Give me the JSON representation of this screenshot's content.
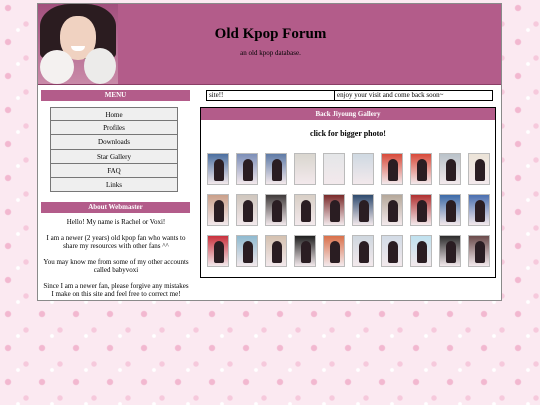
{
  "header": {
    "title": "Old Kpop Forum",
    "subtitle": "an old kpop database."
  },
  "marquee": {
    "left": "site!!",
    "right": "enjoy your visit and come back soon~"
  },
  "sidebar": {
    "menu_heading": "MENU",
    "menu_items": [
      "Home",
      "Profiles",
      "Downloads",
      "Star Gallery",
      "FAQ",
      "Links"
    ],
    "about_heading": "About Webmaster",
    "about_paragraphs": [
      "Hello! My name is Rachel or Voxi!",
      "I am a newer (2 years) old kpop fan who wants to share my resources with other fans ^^",
      "You may know me from some of my other accounts called babyvoxi",
      "Since I am a newer fan, please forgive any mistakes I make on this site and feel free to correct me!"
    ]
  },
  "gallery": {
    "heading": "Back Jiyoung Gallery",
    "instruction": "click for bigger photo!",
    "thumbnails": [
      [
        "#4b6fa0",
        "#7c8fb8",
        "#5e7aa6",
        "#d9d6cf",
        "#e4e6e8",
        "#cfd9e2",
        "#d84a3a",
        "#d84a3a",
        "#b9c2c9",
        "#ece4d8"
      ],
      [
        "#caa08a",
        "#cfc6bd",
        "#3f3a3a",
        "#d8cfc6",
        "#7a2a2a",
        "#2e4a6e",
        "#b5a89a",
        "#b03030",
        "#3c6aa8",
        "#4a6fb0"
      ],
      [
        "#c9303c",
        "#8fbad0",
        "#d4c1b0",
        "#1f1f1f",
        "#d9704a",
        "#cfd7df",
        "#d2dbe6",
        "#bfe1ef",
        "#2b2b2b",
        "#6a4a4a"
      ]
    ]
  }
}
